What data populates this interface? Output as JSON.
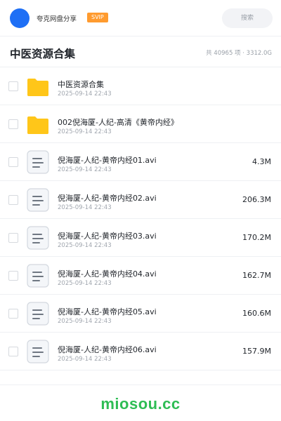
{
  "header": {
    "brand": "夸克网盘分享",
    "badge": "SVIP",
    "search_placeholder": "搜索"
  },
  "titlebar": {
    "title": "中医资源合集",
    "summary": "共 40965 项 · 3312.0G"
  },
  "files": [
    {
      "type": "folder",
      "name": "中医资源合集",
      "date": "2025-09-14 22:43",
      "size": ""
    },
    {
      "type": "folder",
      "name": "002倪海厦-人纪-高清《黄帝内经》",
      "date": "2025-09-14 22:43",
      "size": ""
    },
    {
      "type": "file",
      "name": "倪海厦-人纪-黄帝内经01.avi",
      "date": "2025-09-14 22:43",
      "size": "4.3M"
    },
    {
      "type": "file",
      "name": "倪海厦-人纪-黄帝内经02.avi",
      "date": "2025-09-14 22:43",
      "size": "206.3M"
    },
    {
      "type": "file",
      "name": "倪海厦-人纪-黄帝内经03.avi",
      "date": "2025-09-14 22:43",
      "size": "170.2M"
    },
    {
      "type": "file",
      "name": "倪海厦-人纪-黄帝内经04.avi",
      "date": "2025-09-14 22:43",
      "size": "162.7M"
    },
    {
      "type": "file",
      "name": "倪海厦-人纪-黄帝内经05.avi",
      "date": "2025-09-14 22:43",
      "size": "160.6M"
    },
    {
      "type": "file",
      "name": "倪海厦-人纪-黄帝内经06.avi",
      "date": "2025-09-14 22:43",
      "size": "157.9M"
    }
  ],
  "footer": {
    "watermark": "miosou.cc"
  },
  "colors": {
    "accent": "#1e6ff5",
    "badge": "#ff9b2f",
    "folder": "#ffc61a",
    "watermark": "#2ebd54"
  }
}
